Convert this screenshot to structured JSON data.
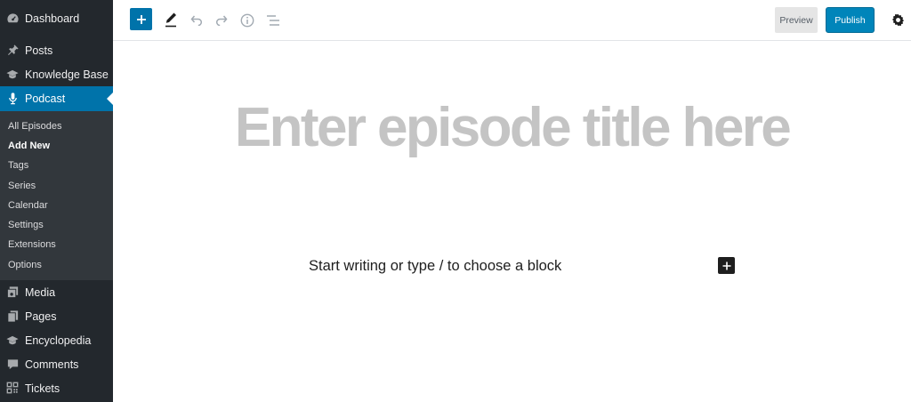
{
  "sidebar": {
    "items": [
      {
        "label": "Dashboard",
        "icon": "dashboard-icon"
      },
      {
        "label": "Posts",
        "icon": "pin-icon"
      },
      {
        "label": "Knowledge Base",
        "icon": "graduation-cap-icon"
      },
      {
        "label": "Podcast",
        "icon": "microphone-icon",
        "active": true
      },
      {
        "label": "Media",
        "icon": "media-icon"
      },
      {
        "label": "Pages",
        "icon": "pages-icon"
      },
      {
        "label": "Encyclopedia",
        "icon": "graduation-cap-icon"
      },
      {
        "label": "Comments",
        "icon": "comment-icon"
      },
      {
        "label": "Tickets",
        "icon": "qr-grid-icon"
      }
    ],
    "submenu": [
      {
        "label": "All Episodes"
      },
      {
        "label": "Add New",
        "current": true
      },
      {
        "label": "Tags"
      },
      {
        "label": "Series"
      },
      {
        "label": "Calendar"
      },
      {
        "label": "Settings"
      },
      {
        "label": "Extensions"
      },
      {
        "label": "Options"
      }
    ]
  },
  "toolbar": {
    "add_block_icon": "plus-icon",
    "tools_icon": "pencil-icon",
    "undo_icon": "undo-icon",
    "redo_icon": "redo-icon",
    "info_icon": "info-icon",
    "outline_icon": "list-outline-icon",
    "preview_label": "Preview",
    "publish_label": "Publish",
    "settings_icon": "gear-icon"
  },
  "editor": {
    "title_placeholder": "Enter episode title here",
    "block_placeholder": "Start writing or type / to choose a block",
    "inserter_icon": "plus-icon"
  },
  "colors": {
    "sidebar_bg": "#23282d",
    "submenu_bg": "#32373c",
    "accent": "#0073aa",
    "publish": "#0085ba",
    "title_placeholder": "#c4c4c4"
  }
}
